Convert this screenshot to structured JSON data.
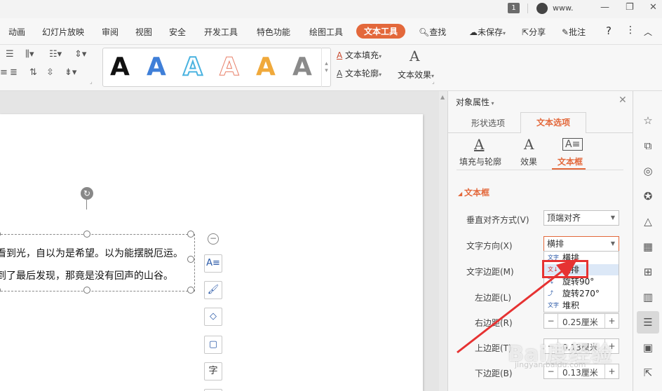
{
  "titlebar": {
    "badge": "1",
    "user": "www.",
    "minimize": "—",
    "restore": "❐",
    "close": "✕"
  },
  "menu": {
    "tabs": [
      {
        "label": "动画"
      },
      {
        "label": "幻灯片放映"
      },
      {
        "label": "审阅"
      },
      {
        "label": "视图"
      },
      {
        "label": "安全"
      },
      {
        "label": "开发工具"
      },
      {
        "label": "特色功能"
      },
      {
        "label": "绘图工具"
      },
      {
        "label": "文本工具"
      }
    ],
    "search": "查找",
    "unsaved": "未保存",
    "share": "分享",
    "comment": "批注",
    "help": "?",
    "more": "⋮",
    "collapse": "︿"
  },
  "ribbon": {
    "text_fill": "文本填充",
    "text_outline": "文本轮廓",
    "text_effect": "文本效果",
    "style_samples": [
      "A",
      "A",
      "A",
      "A",
      "A",
      "A"
    ]
  },
  "slide": {
    "line1": "看到光，自以为是希望。以为能摆脱厄运。",
    "line2": "到了最后发现，那竟是没有回声的山谷。"
  },
  "panel": {
    "title": "对象属性",
    "close": "✕",
    "tabs": {
      "shape": "形状选项",
      "text": "文本选项"
    },
    "subtabs": {
      "fill": "填充与轮廓",
      "effect": "效果",
      "textbox": "文本框"
    },
    "section": "文本框",
    "valign_label": "垂直对齐方式(V)",
    "valign_value": "顶端对齐",
    "direction_label": "文字方向(X)",
    "direction_value": "横排",
    "margin_label": "文字边距(M)",
    "left_label": "左边距(L)",
    "right_label": "右边距(R)",
    "right_value": "0.25厘米",
    "top_label": "上边距(T)",
    "top_value": "0.13厘米",
    "bottom_label": "下边距(B)",
    "bottom_value": "0.13厘米",
    "dropdown_options": [
      "横排",
      "竖排",
      "旋转90°",
      "旋转270°",
      "堆积"
    ]
  },
  "watermark": {
    "main": "Bai度经验",
    "sub": "jingyan.baidu.com"
  },
  "colors": {
    "accent": "#e3683b",
    "highlight": "#e63232"
  }
}
